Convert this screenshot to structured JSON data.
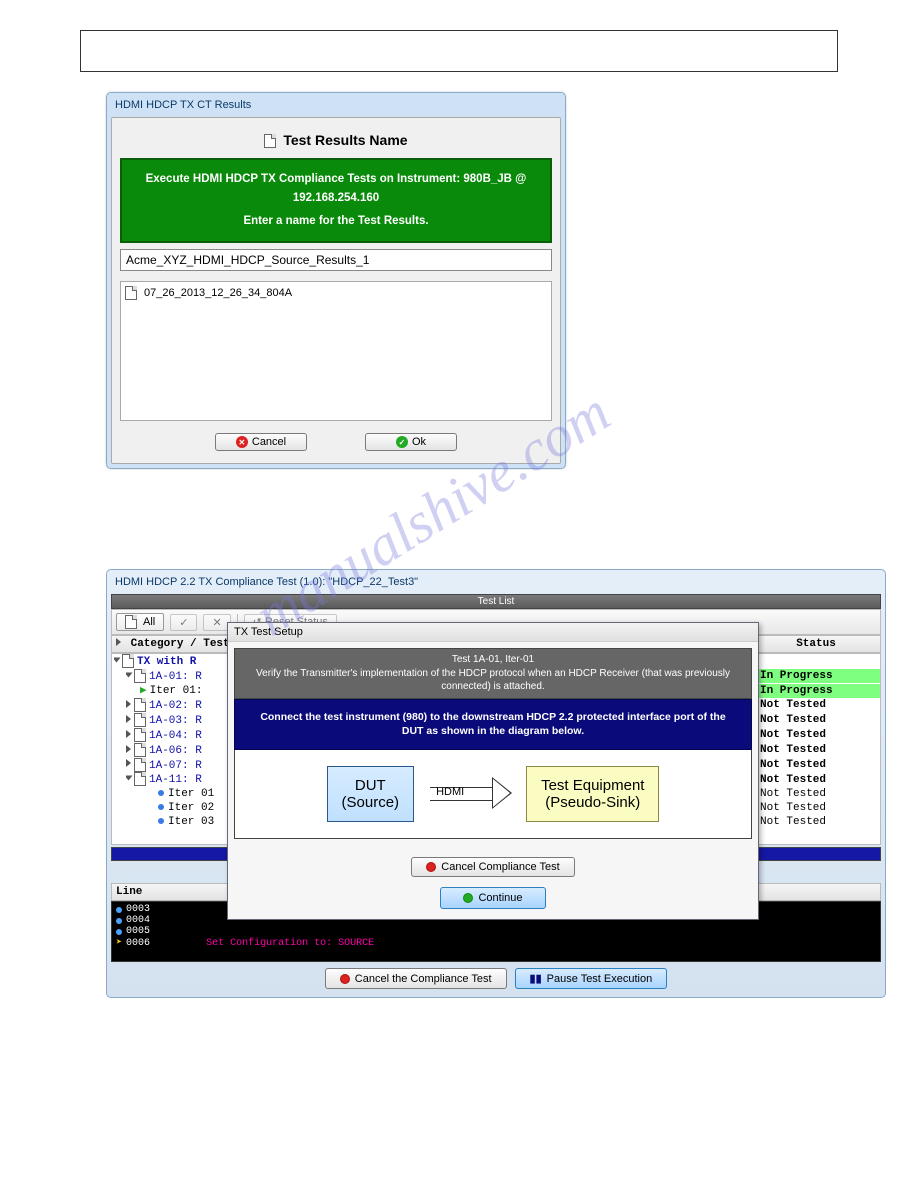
{
  "dialog1": {
    "window_title": "HDMI HDCP TX CT Results",
    "header": "Test Results Name",
    "banner_line1": "Execute HDMI HDCP TX Compliance Tests on Instrument: 980B_JB @ 192.168.254.160",
    "banner_line2": "Enter a name for the Test Results.",
    "input_value": "Acme_XYZ_HDMI_HDCP_Source_Results_1",
    "list_item": "07_26_2013_12_26_34_804A",
    "cancel": "Cancel",
    "ok": "Ok"
  },
  "watermark": "manualshive.com",
  "window2": {
    "title": "HDMI HDCP 2.2 TX Compliance Test (1.0): \"HDCP_22_Test3\"",
    "panel_header": "Test List",
    "toolbar": {
      "all": "All",
      "reset": "Reset Status"
    },
    "columns": {
      "col1": "Category / Test Name",
      "col2": "Status"
    },
    "tree": {
      "root": "TX with R",
      "n_1a01": "1A-01: R",
      "iter01": "Iter 01:",
      "n_1a02": "1A-02: R",
      "n_1a03": "1A-03: R",
      "n_1a04": "1A-04: R",
      "n_1a06": "1A-06: R",
      "n_1a07": "1A-07: R",
      "n_1a11": "1A-11: R",
      "iter1": "Iter 01",
      "iter2": "Iter 02",
      "iter3": "Iter 03"
    },
    "status": {
      "in_progress": "In Progress",
      "not_tested": "Not Tested"
    },
    "tx_setup": {
      "title": "TX Test Setup",
      "gray_l1": "Test 1A-01, Iter-01",
      "gray_l2": "Verify the Transmitter's implementation of the HDCP protocol when an HDCP Receiver (that was previously connected) is attached.",
      "blue_l1": "Connect the test instrument (980) to the downstream HDCP 2.2 protected interface port of the DUT as shown in the diagram below.",
      "dut_l1": "DUT",
      "dut_l2": "(Source)",
      "hdmi": "HDMI",
      "eq_l1": "Test Equipment",
      "eq_l2": "(Pseudo-Sink)",
      "cancel": "Cancel Compliance Test",
      "continue": "Continue"
    },
    "console": {
      "header_col": "Line",
      "rows": [
        "0003",
        "0004",
        "0005",
        "0006"
      ],
      "pink": "Set Configuration to: SOURCE"
    },
    "bottom": {
      "cancel": "Cancel the Compliance Test",
      "pause": "Pause Test Execution"
    }
  }
}
